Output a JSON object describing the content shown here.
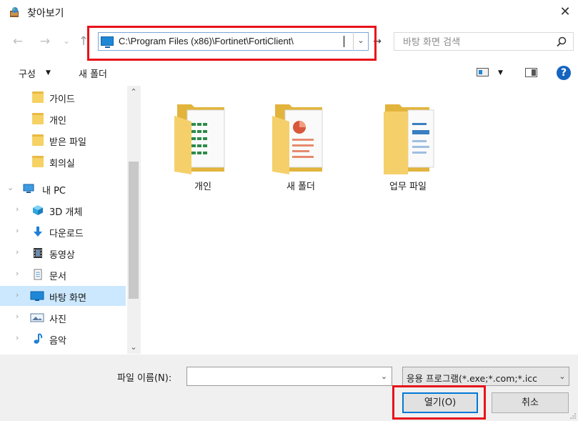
{
  "window": {
    "title": "찾아보기",
    "close_label": "✕"
  },
  "nav": {
    "back": "←",
    "forward": "→",
    "recent": "⌄",
    "up": "↑",
    "address": "C:\\Program Files (x86)\\Fortinet\\FortiClient\\",
    "address_dropdown": "⌄",
    "refresh": "→",
    "search_placeholder": "바탕 화면 검색"
  },
  "toolbar": {
    "organize": "구성",
    "organize_arrow": "▼",
    "new_folder": "새 폴더",
    "view_arrow": "▼",
    "help": "?"
  },
  "sidebar": {
    "items": [
      {
        "label": "가이드",
        "icon": "folder-icon"
      },
      {
        "label": "개인",
        "icon": "folder-icon"
      },
      {
        "label": "받은 파일",
        "icon": "folder-icon"
      },
      {
        "label": "회의실",
        "icon": "folder-icon"
      },
      {
        "label": "내 PC",
        "icon": "pc-icon",
        "chevron": "⌄"
      },
      {
        "label": "3D 개체",
        "icon": "cube-icon",
        "chevron": "›"
      },
      {
        "label": "다운로드",
        "icon": "download-icon",
        "chevron": "›"
      },
      {
        "label": "동영상",
        "icon": "video-icon",
        "chevron": "›"
      },
      {
        "label": "문서",
        "icon": "document-icon",
        "chevron": "›"
      },
      {
        "label": "바탕 화면",
        "icon": "desktop-icon",
        "chevron": "›",
        "selected": true
      },
      {
        "label": "사진",
        "icon": "picture-icon",
        "chevron": "›"
      },
      {
        "label": "음악",
        "icon": "music-icon",
        "chevron": "›"
      }
    ],
    "scroll_up": "⌃",
    "scroll_down": "⌄"
  },
  "content": {
    "items": [
      {
        "label": "개인",
        "accent": "#2e8b4a"
      },
      {
        "label": "새 폴더",
        "accent": "#d9583b"
      },
      {
        "label": "업무 파일",
        "accent": "#3a7fc0"
      }
    ]
  },
  "footer": {
    "filename_label": "파일 이름(N):",
    "filename_value": "",
    "filename_dropdown": "⌄",
    "filetype": "응용 프로그램(*.exe;*.com;*.icc",
    "filetype_dropdown": "⌄",
    "open": "열기(O)",
    "cancel": "취소"
  },
  "colors": {
    "highlight": "#e8121a",
    "accent": "#0078d7",
    "selected": "#cce8ff"
  }
}
